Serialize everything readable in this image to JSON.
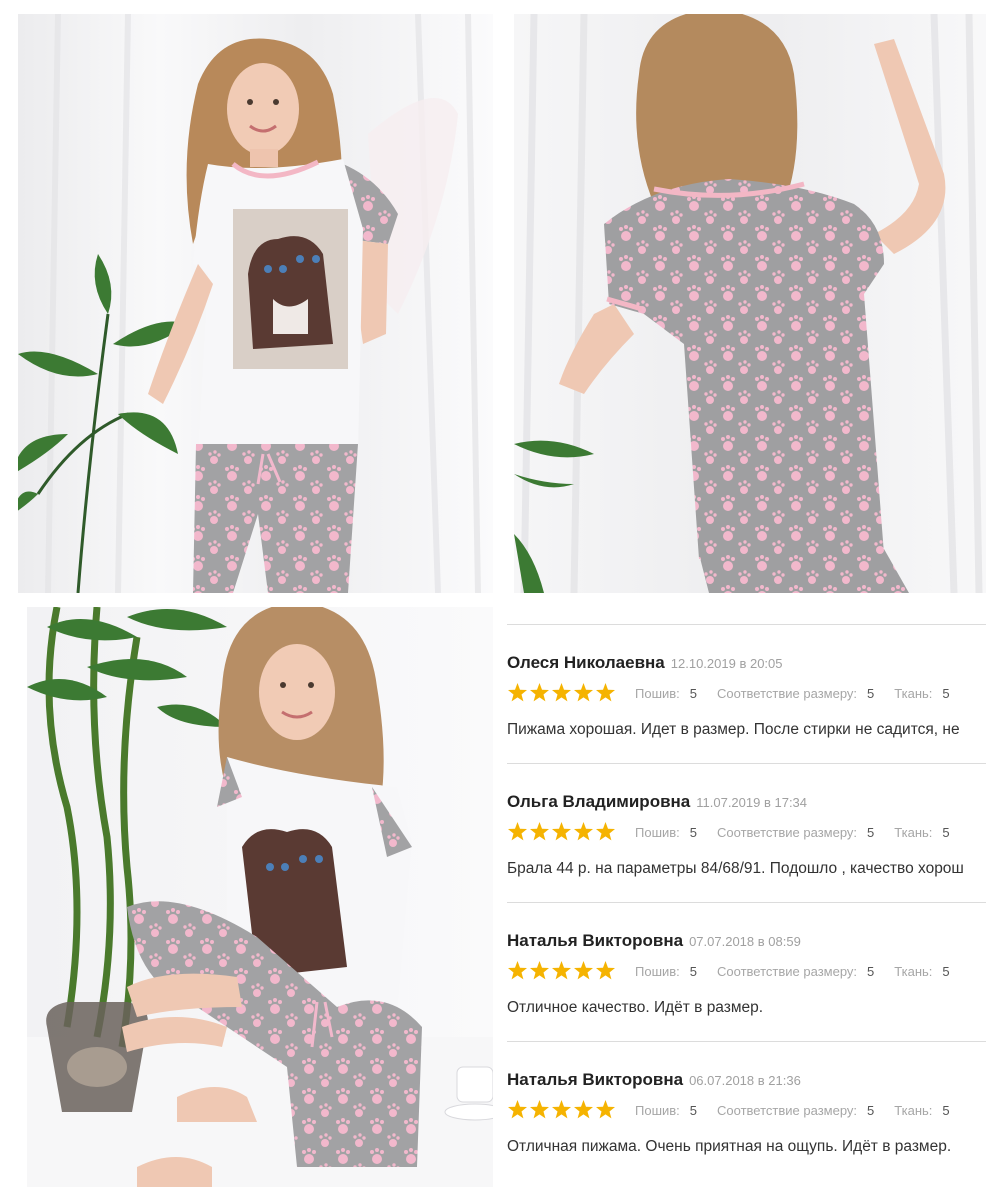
{
  "colors": {
    "star": "#f5b301",
    "divider": "#dcdcdc",
    "author": "#222222",
    "meta": "#a0a0a0",
    "text": "#333333",
    "pajama_gray": "#9d9d9f",
    "paw_pink": "#f2b8cc"
  },
  "photos": [
    {
      "name": "front-view"
    },
    {
      "name": "back-view"
    },
    {
      "name": "seated-view"
    }
  ],
  "reviews": [
    {
      "author": "Олеся Николаевна",
      "date": "12.10.2019 в 20:05",
      "stars": 5,
      "metrics": [
        {
          "label": "Пошив:",
          "value": "5"
        },
        {
          "label": "Соответствие размеру:",
          "value": "5"
        },
        {
          "label": "Ткань:",
          "value": "5"
        }
      ],
      "text": "Пижама хорошая. Идет в размер. После стирки не садится, не"
    },
    {
      "author": "Ольга Владимировна",
      "date": "11.07.2019 в 17:34",
      "stars": 5,
      "metrics": [
        {
          "label": "Пошив:",
          "value": "5"
        },
        {
          "label": "Соответствие размеру:",
          "value": "5"
        },
        {
          "label": "Ткань:",
          "value": "5"
        }
      ],
      "text": "Брала 44 р. на параметры 84/68/91. Подошло , качество хорош"
    },
    {
      "author": "Наталья Викторовна",
      "date": "07.07.2018 в 08:59",
      "stars": 5,
      "metrics": [
        {
          "label": "Пошив:",
          "value": "5"
        },
        {
          "label": "Соответствие размеру:",
          "value": "5"
        },
        {
          "label": "Ткань:",
          "value": "5"
        }
      ],
      "text": "Отличное качество. Идёт в размер."
    },
    {
      "author": "Наталья Викторовна",
      "date": "06.07.2018 в 21:36",
      "stars": 5,
      "metrics": [
        {
          "label": "Пошив:",
          "value": "5"
        },
        {
          "label": "Соответствие размеру:",
          "value": "5"
        },
        {
          "label": "Ткань:",
          "value": "5"
        }
      ],
      "text": "Отличная пижама. Очень приятная на ощупь. Идёт в размер."
    }
  ]
}
